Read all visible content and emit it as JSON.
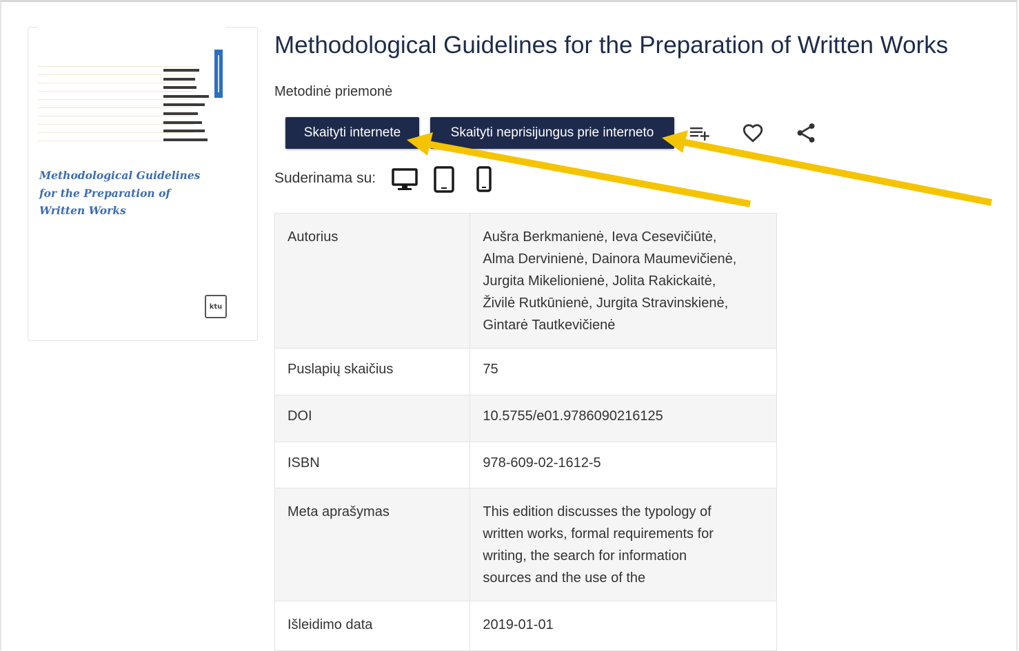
{
  "cover": {
    "title_lines": [
      "Methodological Guidelines",
      "for the Preparation of",
      "Written Works"
    ],
    "logo_text": "ktu",
    "title_color": "#3d6db4"
  },
  "header": {
    "title": "Methodological Guidelines for the Preparation of Written Works",
    "subtitle": "Metodinė priemonė"
  },
  "actions": {
    "read_online_label": "Skaityti internete",
    "read_offline_label": "Skaityti neprisijungus prie interneto",
    "icons": [
      "playlist-add-icon",
      "heart-icon",
      "share-icon"
    ]
  },
  "compatibility": {
    "label": "Suderinama su:",
    "devices": [
      "desktop-icon",
      "tablet-icon",
      "phone-icon"
    ]
  },
  "details": [
    {
      "key": "Autorius",
      "lines": [
        "Aušra Berkmanienė, Ieva Cesevičiūtė,",
        "Alma Dervinienė, Dainora Maumevičienė,",
        "Jurgita Mikelionienė, Jolita Rakickaitė,",
        "Živilė Rutkūnienė, Jurgita Stravinskienė,",
        "Gintarė Tautkevičienė"
      ]
    },
    {
      "key": "Puslapių skaičius",
      "lines": [
        "75"
      ]
    },
    {
      "key": "DOI",
      "lines": [
        "10.5755/e01.9786090216125"
      ]
    },
    {
      "key": "ISBN",
      "lines": [
        "978-609-02-1612-5"
      ]
    },
    {
      "key": "Meta aprašymas",
      "lines": [
        "This edition discusses the typology of",
        "written works, formal requirements for",
        "writing, the search for information",
        "sources and the use of the"
      ]
    },
    {
      "key": "Išleidimo data",
      "lines": [
        "2019-01-01"
      ]
    }
  ],
  "colors": {
    "button_bg": "#1e2a4c",
    "title_color": "#1e2b4a",
    "annotation_arrow": "#f5c400"
  }
}
